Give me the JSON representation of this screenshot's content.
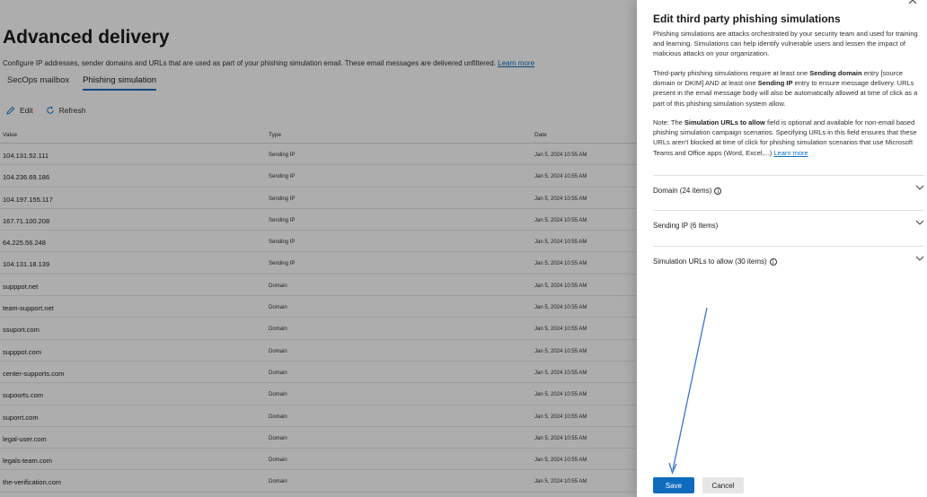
{
  "page": {
    "title": "Advanced delivery",
    "description": "Configure IP addresses, sender domains and URLs that are used as part of your phishing simulation email. These email messages are delivered unfiltered.",
    "learn_more": "Learn more",
    "tabs": [
      {
        "label": "SecOps mailbox",
        "active": false
      },
      {
        "label": "Phishing simulation",
        "active": true
      }
    ],
    "toolbar": {
      "edit": "Edit",
      "refresh": "Refresh"
    },
    "table": {
      "columns": [
        "Value",
        "Type",
        "Date"
      ],
      "rows": [
        {
          "value": "104.131.52.111",
          "type": "Sending IP",
          "date": "Jan 5, 2024 10:55 AM"
        },
        {
          "value": "104.236.69.186",
          "type": "Sending IP",
          "date": "Jan 5, 2024 10:55 AM"
        },
        {
          "value": "104.197.155.117",
          "type": "Sending IP",
          "date": "Jan 5, 2024 10:55 AM"
        },
        {
          "value": "167.71.100.208",
          "type": "Sending IP",
          "date": "Jan 5, 2024 10:55 AM"
        },
        {
          "value": "64.225.56.248",
          "type": "Sending IP",
          "date": "Jan 5, 2024 10:55 AM"
        },
        {
          "value": "104.131.18.139",
          "type": "Sending IP",
          "date": "Jan 5, 2024 10:55 AM"
        },
        {
          "value": "supppot.net",
          "type": "Domain",
          "date": "Jan 5, 2024 10:55 AM"
        },
        {
          "value": "team-support.net",
          "type": "Domain",
          "date": "Jan 5, 2024 10:55 AM"
        },
        {
          "value": "ssuport.com",
          "type": "Domain",
          "date": "Jan 5, 2024 10:55 AM"
        },
        {
          "value": "supppot.com",
          "type": "Domain",
          "date": "Jan 5, 2024 10:55 AM"
        },
        {
          "value": "center-supports.com",
          "type": "Domain",
          "date": "Jan 5, 2024 10:55 AM"
        },
        {
          "value": "supoorts.com",
          "type": "Domain",
          "date": "Jan 5, 2024 10:55 AM"
        },
        {
          "value": "suporrt.com",
          "type": "Domain",
          "date": "Jan 5, 2024 10:55 AM"
        },
        {
          "value": "legal-user.com",
          "type": "Domain",
          "date": "Jan 5, 2024 10:55 AM"
        },
        {
          "value": "legals-team.com",
          "type": "Domain",
          "date": "Jan 5, 2024 10:55 AM"
        },
        {
          "value": "the-verification.com",
          "type": "Domain",
          "date": "Jan 5, 2024 10:55 AM"
        }
      ]
    }
  },
  "panel": {
    "title": "Edit third party phishing simulations",
    "close_icon": "close-icon",
    "p1": "Phishing simulations are attacks orchestrated by your security team and used for training and learning. Simulations can help identify vulnerable users and lessen the impact of malicious attacks on your organization.",
    "p2_a": "Third-party phishing simulations require at least one ",
    "p2_b": "Sending domain",
    "p2_c": " entry [source domain or DKIM] AND at least one ",
    "p2_d": "Sending IP",
    "p2_e": " entry to ensure message delivery. URLs present in the email message body will also be automatically allowed at time of click as a part of this phishing simulation system allow.",
    "p3_a": "Note: The ",
    "p3_b": "Simulation URLs to allow",
    "p3_c": " field is optional and available for non-email based phishing simulation campaign scenarios. Specifying URLs in this field ensures that these URLs aren't blocked at time of click for phishing simulation scenarios that use Microsoft Teams and Office apps (Word, Excel,...) ",
    "p3_link": "Learn more",
    "sections": [
      {
        "label": "Domain (24 items)",
        "info": true
      },
      {
        "label": "Sending IP (6 items)",
        "info": false
      },
      {
        "label": "Simulation URLs to allow (30 items)",
        "info": true
      }
    ],
    "save": "Save",
    "cancel": "Cancel"
  },
  "colors": {
    "accent": "#0f6cbd",
    "overlay": "rgba(0,0,0,0.32)"
  }
}
